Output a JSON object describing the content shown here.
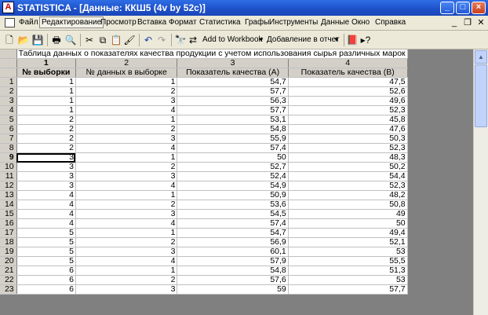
{
  "window": {
    "title": "STATISTICA - [Данные: ККШ5 (4v by 52c)]",
    "app_icon_glyph": "A"
  },
  "menu": {
    "items": [
      "Файл",
      "Редактирование",
      "Просмотр",
      "Вставка",
      "Формат",
      "Статистика",
      "Графы",
      "Инструменты",
      "Данные",
      "Окно",
      "Справка"
    ],
    "active_index": 1
  },
  "toolbar": {
    "add_to_workbook": "Add to Workbook",
    "add_to_report": "Добавление в отчет"
  },
  "sheet": {
    "info_row": "Таблица данных о показателях качества продукции с учетом использования сырья различных марок",
    "column_numbers": [
      "1",
      "2",
      "3",
      "4"
    ],
    "column_names": [
      "№ выборки",
      "№ данных в выборке",
      "Показатель качества (А)",
      "Показатель качества (В)"
    ],
    "selected_row": "9",
    "rows": [
      {
        "n": "1",
        "c": [
          "1",
          "1",
          "54,7",
          "47,5"
        ]
      },
      {
        "n": "2",
        "c": [
          "1",
          "2",
          "57,7",
          "52,6"
        ]
      },
      {
        "n": "3",
        "c": [
          "1",
          "3",
          "56,3",
          "49,6"
        ]
      },
      {
        "n": "4",
        "c": [
          "1",
          "4",
          "57,7",
          "52,3"
        ]
      },
      {
        "n": "5",
        "c": [
          "2",
          "1",
          "53,1",
          "45,8"
        ]
      },
      {
        "n": "6",
        "c": [
          "2",
          "2",
          "54,8",
          "47,6"
        ]
      },
      {
        "n": "7",
        "c": [
          "2",
          "3",
          "55,9",
          "50,3"
        ]
      },
      {
        "n": "8",
        "c": [
          "2",
          "4",
          "57,4",
          "52,3"
        ]
      },
      {
        "n": "9",
        "c": [
          "3",
          "1",
          "50",
          "48,3"
        ]
      },
      {
        "n": "10",
        "c": [
          "3",
          "2",
          "52,7",
          "50,2"
        ]
      },
      {
        "n": "11",
        "c": [
          "3",
          "3",
          "52,4",
          "54,4"
        ]
      },
      {
        "n": "12",
        "c": [
          "3",
          "4",
          "54,9",
          "52,3"
        ]
      },
      {
        "n": "13",
        "c": [
          "4",
          "1",
          "50,9",
          "48,2"
        ]
      },
      {
        "n": "14",
        "c": [
          "4",
          "2",
          "53,6",
          "50,8"
        ]
      },
      {
        "n": "15",
        "c": [
          "4",
          "3",
          "54,5",
          "49"
        ]
      },
      {
        "n": "16",
        "c": [
          "4",
          "4",
          "57,4",
          "50"
        ]
      },
      {
        "n": "17",
        "c": [
          "5",
          "1",
          "54,7",
          "49,4"
        ]
      },
      {
        "n": "18",
        "c": [
          "5",
          "2",
          "56,9",
          "52,1"
        ]
      },
      {
        "n": "19",
        "c": [
          "5",
          "3",
          "60,1",
          "53"
        ]
      },
      {
        "n": "20",
        "c": [
          "5",
          "4",
          "57,9",
          "55,5"
        ]
      },
      {
        "n": "21",
        "c": [
          "6",
          "1",
          "54,8",
          "51,3"
        ]
      },
      {
        "n": "22",
        "c": [
          "6",
          "2",
          "57,6",
          "53"
        ]
      },
      {
        "n": "23",
        "c": [
          "6",
          "3",
          "59",
          "57,7"
        ]
      }
    ]
  },
  "colors": {
    "titlebar": "#1d4fc8",
    "gray_area": "#808080",
    "header_bg": "#d4d0c8"
  }
}
